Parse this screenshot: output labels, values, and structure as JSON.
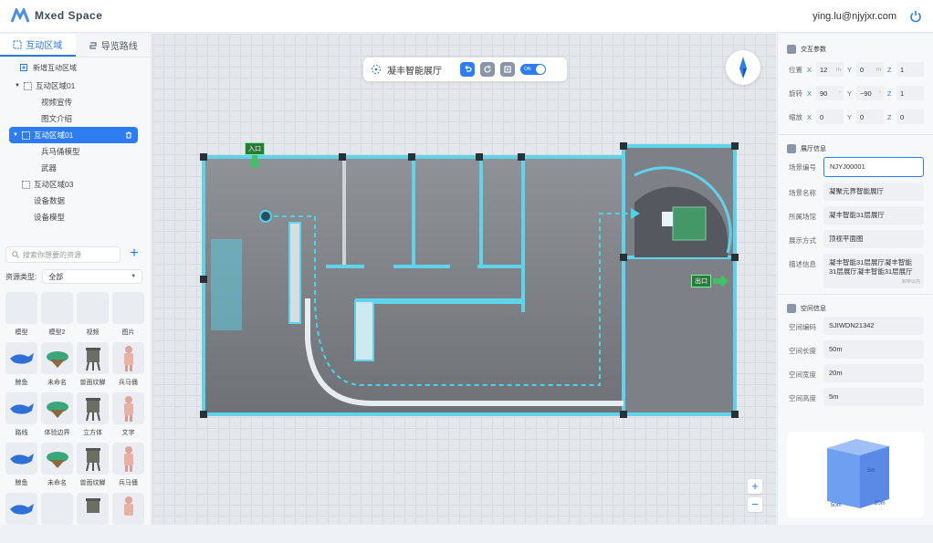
{
  "header": {
    "brand": "Mxed Space",
    "user": "ying.lu@njyjxr.com"
  },
  "left": {
    "tabs": [
      {
        "label": "互动区域"
      },
      {
        "label": "导览路线"
      }
    ],
    "add_label": "新增互动区域",
    "tree": [
      {
        "label": "互动区域01",
        "level": 0
      },
      {
        "label": "视频宣传",
        "level": 1
      },
      {
        "label": "图文介绍",
        "level": 1
      },
      {
        "label": "互动区域01",
        "level": 0
      },
      {
        "label": "兵马俑模型",
        "level": 1
      },
      {
        "label": "武器",
        "level": 1
      },
      {
        "label": "互动区域03",
        "level": 0
      },
      {
        "label": "设备数据",
        "level": 1
      },
      {
        "label": "设备模型",
        "level": 1
      }
    ],
    "search_placeholder": "搜索你想要的资源",
    "type_label": "资源类型:",
    "type_value": "全部",
    "assets": [
      "模型",
      "模型2",
      "视频",
      "图片",
      "鲸鱼",
      "未命名",
      "兽面纹觯",
      "兵马俑",
      "路线",
      "体验边界",
      "立方体",
      "文字",
      "鲸鱼",
      "未命名",
      "兽面纹觯",
      "兵马俑"
    ]
  },
  "canvas": {
    "title": "凝丰智能展厅",
    "toggle_label": "ON",
    "entrance": "入口",
    "exit": "出口",
    "zoom_in": "+",
    "zoom_out": "−"
  },
  "right": {
    "interact_title": "交互参数",
    "position": {
      "label": "位置",
      "x": "12",
      "y": "0",
      "z": "1",
      "xu": "m",
      "yu": "m"
    },
    "rotation": {
      "label": "旋转",
      "x": "90",
      "y": "−90",
      "z": "1",
      "xu": "°",
      "yu": "°"
    },
    "scale": {
      "label": "缩放",
      "x": "0",
      "y": "0",
      "z": "0"
    },
    "hall_title": "展厅信息",
    "hall_fields": [
      {
        "label": "场景编号",
        "value": "NJYJ00001"
      },
      {
        "label": "场景名称",
        "value": "凝聚元界智能展厅"
      },
      {
        "label": "所属场馆",
        "value": "凝丰智能31层展厅"
      },
      {
        "label": "展示方式",
        "value": "顶视平面图"
      },
      {
        "label": "描述信息",
        "value": "凝丰智能31层展厅凝丰智能31层展厅凝丰智能31层展厅"
      }
    ],
    "desc_count": "30字以内",
    "space_title": "空间信息",
    "space_fields": [
      {
        "label": "空间编码",
        "value": "SJIWDN21342"
      },
      {
        "label": "空间长度",
        "value": "50m"
      },
      {
        "label": "空间宽度",
        "value": "20m"
      },
      {
        "label": "空间高度",
        "value": "5m"
      }
    ],
    "cube": {
      "height": "5m",
      "length": "50m",
      "width": "20m"
    }
  },
  "accent": "#2d7df0"
}
